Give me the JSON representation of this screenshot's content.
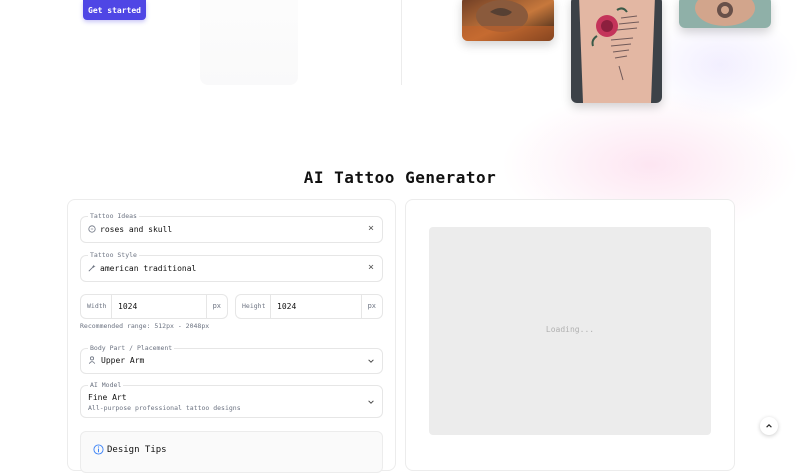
{
  "hero": {
    "cta_label": "Get started",
    "cta_color": "#4f46e5"
  },
  "generator": {
    "title": "AI Tattoo Generator",
    "tattoo_ideas": {
      "label": "Tattoo Ideas",
      "value": "roses and skull",
      "icon": "lightbulb-icon",
      "clear_icon": "close-icon",
      "clear_glyph": "×"
    },
    "tattoo_style": {
      "label": "Tattoo Style",
      "value": "american traditional",
      "icon": "wand-icon",
      "clear_icon": "close-icon",
      "clear_glyph": "×"
    },
    "width": {
      "label": "Width",
      "value": "1024",
      "unit": "px"
    },
    "height": {
      "label": "Height",
      "value": "1024",
      "unit": "px"
    },
    "range_hint": "Recommended range: 512px - 2048px",
    "body_part": {
      "label": "Body Part / Placement",
      "value": "Upper Arm",
      "icon": "person-icon"
    },
    "ai_model": {
      "label": "AI Model",
      "value": "Fine Art",
      "description": "All-purpose professional tattoo designs"
    },
    "tips": {
      "label": "Design Tips",
      "icon": "info-icon"
    }
  },
  "preview": {
    "loading_text": "Loading..."
  },
  "scroll_top": {
    "icon": "chevron-up-icon"
  }
}
